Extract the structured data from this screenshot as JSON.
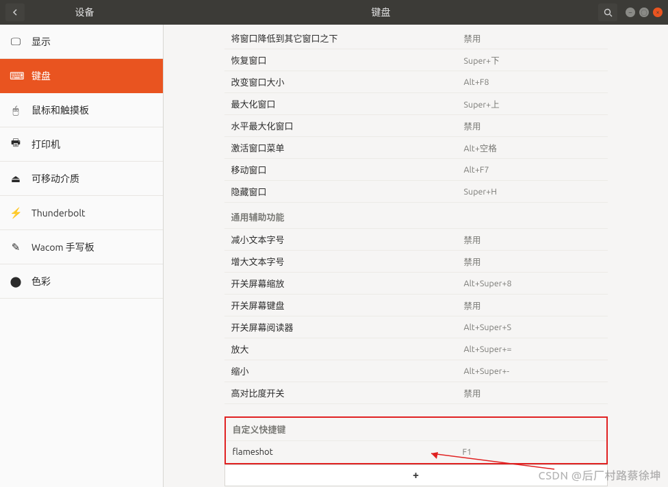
{
  "titlebar": {
    "sidebar_title": "设备",
    "main_title": "键盘"
  },
  "sidebar": {
    "items": [
      {
        "icon": "display-icon",
        "glyph": "🖵",
        "label": "显示"
      },
      {
        "icon": "keyboard-icon",
        "glyph": "⌨",
        "label": "键盘"
      },
      {
        "icon": "mouse-icon",
        "glyph": "🖱",
        "label": "鼠标和触摸板"
      },
      {
        "icon": "printer-icon",
        "glyph": "🖶",
        "label": "打印机"
      },
      {
        "icon": "removable-icon",
        "glyph": "⏏",
        "label": "可移动介质"
      },
      {
        "icon": "thunderbolt-icon",
        "glyph": "⚡",
        "label": "Thunderbolt"
      },
      {
        "icon": "wacom-icon",
        "glyph": "✎",
        "label": "Wacom 手写板"
      },
      {
        "icon": "color-icon",
        "glyph": "⬤",
        "label": "色彩"
      }
    ],
    "active_index": 1
  },
  "content": {
    "window_rows": [
      {
        "label": "将窗口降低到其它窗口之下",
        "key": "禁用"
      },
      {
        "label": "恢复窗口",
        "key": "Super+下"
      },
      {
        "label": "改变窗口大小",
        "key": "Alt+F8"
      },
      {
        "label": "最大化窗口",
        "key": "Super+上"
      },
      {
        "label": "水平最大化窗口",
        "key": "禁用"
      },
      {
        "label": "激活窗口菜单",
        "key": "Alt+空格"
      },
      {
        "label": "移动窗口",
        "key": "Alt+F7"
      },
      {
        "label": "隐藏窗口",
        "key": "Super+H"
      }
    ],
    "a11y_header": "通用辅助功能",
    "a11y_rows": [
      {
        "label": "减小文本字号",
        "key": "禁用"
      },
      {
        "label": "增大文本字号",
        "key": "禁用"
      },
      {
        "label": "开关屏幕缩放",
        "key": "Alt+Super+8"
      },
      {
        "label": "开关屏幕键盘",
        "key": "禁用"
      },
      {
        "label": "开关屏幕阅读器",
        "key": "Alt+Super+S"
      },
      {
        "label": "放大",
        "key": "Alt+Super+="
      },
      {
        "label": "缩小",
        "key": "Alt+Super+-"
      },
      {
        "label": "高对比度开关",
        "key": "禁用"
      }
    ],
    "custom_header": "自定义快捷键",
    "custom_rows": [
      {
        "label": "flameshot",
        "key": "F1"
      }
    ],
    "add_label": "+"
  },
  "watermark": "CSDN @后厂村路蔡徐坤"
}
